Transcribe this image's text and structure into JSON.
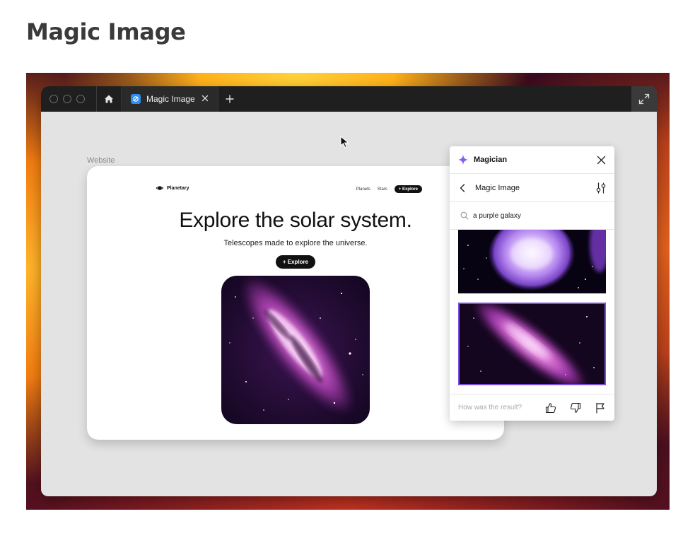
{
  "page": {
    "title": "Magic Image"
  },
  "browser": {
    "tab_label": "Magic Image",
    "icons": {
      "home": "home-icon",
      "new_tab": "plus-icon",
      "close": "close-icon",
      "expand": "expand-icon"
    }
  },
  "canvas": {
    "frame_label": "Website"
  },
  "website": {
    "brand": "Planetary",
    "nav": [
      "Planets",
      "Stars"
    ],
    "nav_cta": "+ Explore",
    "hero_title": "Explore the solar system.",
    "hero_subtitle": "Telescopes made to explore the universe.",
    "hero_button": "+ Explore"
  },
  "magician": {
    "title": "Magician",
    "subtitle": "Magic Image",
    "search_value": "a purple galaxy",
    "feedback_prompt": "How was the result?",
    "accent_color": "#7a4fe0"
  }
}
